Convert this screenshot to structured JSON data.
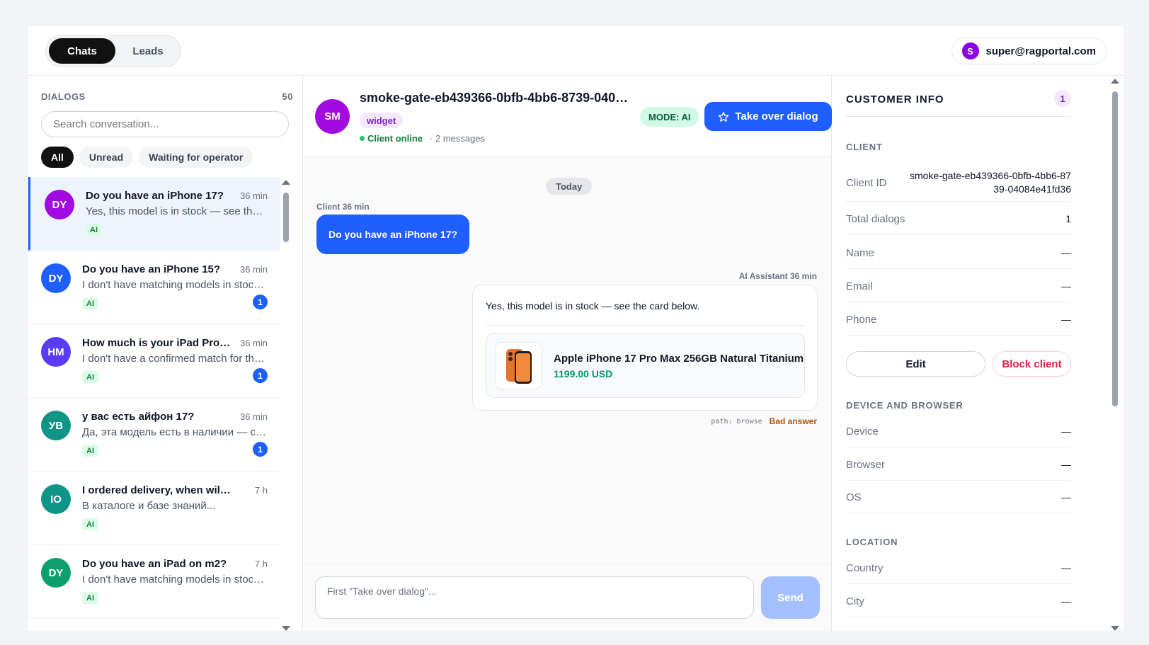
{
  "tabs": [
    {
      "label": "Chats",
      "active": true
    },
    {
      "label": "Leads",
      "active": false
    }
  ],
  "user": {
    "initial": "S",
    "email": "super@ragportal.com",
    "color": "#8b00e6"
  },
  "dialogs": {
    "header": "DIALOGS",
    "count": "50",
    "search_placeholder": "Search conversation...",
    "filters": [
      {
        "label": "All",
        "active": true
      },
      {
        "label": "Unread",
        "active": false
      },
      {
        "label": "Waiting for operator",
        "active": false
      }
    ],
    "items": [
      {
        "initials": "DY",
        "color": "#a10ae0",
        "title": "Do you have an iPhone 17?",
        "time": "36 min",
        "preview": "Yes, this model is in stock — see the card below.",
        "tag": "AI",
        "unread": "",
        "selected": true
      },
      {
        "initials": "DY",
        "color": "#1f5eff",
        "title": "Do you have an iPhone 15?",
        "time": "36 min",
        "preview": "I don't have matching models in stock right now.",
        "tag": "AI",
        "unread": "1",
        "selected": false
      },
      {
        "initials": "HM",
        "color": "#5b3cf5",
        "title": "How much is your iPad Pro on M4?",
        "time": "36 min",
        "preview": "I don't have a confirmed match for that model.",
        "tag": "AI",
        "unread": "1",
        "selected": false
      },
      {
        "initials": "УВ",
        "color": "#0f9488",
        "title": "у вас есть айфон 17?",
        "time": "36 min",
        "preview": "Да, эта модель есть в наличии — см. карточку ниже.",
        "tag": "AI",
        "unread": "1",
        "selected": false
      },
      {
        "initials": "IO",
        "color": "#0f9488",
        "title": "I ordered delivery, when will you bring it?",
        "time": "7 h",
        "preview": "В каталоге и базе знаний...",
        "tag": "AI",
        "unread": "",
        "selected": false
      },
      {
        "initials": "DY",
        "color": "#0e9f6e",
        "title": "Do you have an iPad on m2?",
        "time": "7 h",
        "preview": "I don't have matching models in stock right now.",
        "tag": "AI",
        "unread": "",
        "selected": false
      }
    ]
  },
  "chat": {
    "avatar_initials": "SM",
    "title": "smoke-gate-eb439366-0bfb-4bb6-8739-04084e41fd36",
    "channel_tag": "widget",
    "status": "Client online",
    "messages_count": "· 2 messages",
    "mode": "MODE: AI",
    "take_over_label": "Take over dialog",
    "day_separator": "Today",
    "client_meta": "Client 36 min",
    "client_message": "Do you have an iPhone 17?",
    "ai_meta": "AI Assistant 36 min",
    "ai_message": "Yes, this model is in stock — see the card below.",
    "product": {
      "name": "Apple iPhone 17 Pro Max 256GB Natural Titanium",
      "price": "1199.00 USD"
    },
    "path": "path: browse",
    "bad_answer": "Bad answer",
    "composer_placeholder": "First \"Take over dialog\"...",
    "send_label": "Send"
  },
  "customer": {
    "title": "CUSTOMER INFO",
    "badge": "1",
    "client_section": "CLIENT",
    "client_id_label": "Client ID",
    "client_id_line1": "smoke-gate-eb439366-0bfb-4bb6-87",
    "client_id_line2": "39-04084e41fd36",
    "total_dialogs_label": "Total dialogs",
    "total_dialogs": "1",
    "name_label": "Name",
    "name": "—",
    "email_label": "Email",
    "email": "—",
    "phone_label": "Phone",
    "phone": "—",
    "edit_label": "Edit",
    "block_label": "Block client",
    "device_section": "DEVICE AND BROWSER",
    "device_label": "Device",
    "device": "—",
    "browser_label": "Browser",
    "browser": "—",
    "os_label": "OS",
    "os": "—",
    "location_section": "LOCATION",
    "country_label": "Country",
    "country": "—",
    "city_label": "City",
    "city": "—"
  }
}
